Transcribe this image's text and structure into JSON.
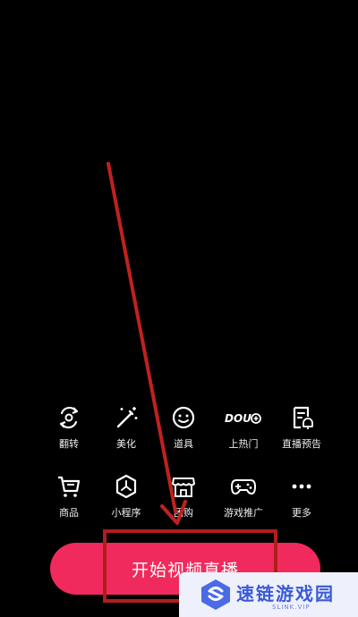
{
  "toolbar_row1": [
    {
      "label": "翻转",
      "icon": "flip-camera-icon"
    },
    {
      "label": "美化",
      "icon": "magic-wand-icon"
    },
    {
      "label": "道具",
      "icon": "smiley-face-icon"
    },
    {
      "label": "上热门",
      "icon": "dou-plus-icon",
      "icon_text": "DOU"
    },
    {
      "label": "直播预告",
      "icon": "schedule-bell-icon"
    }
  ],
  "toolbar_row2": [
    {
      "label": "商品",
      "icon": "shopping-cart-icon"
    },
    {
      "label": "小程序",
      "icon": "mini-program-icon"
    },
    {
      "label": "团购",
      "icon": "group-buy-store-icon"
    },
    {
      "label": "游戏推广",
      "icon": "gamepad-icon"
    },
    {
      "label": "更多",
      "icon": "more-dots-icon"
    }
  ],
  "start_button": {
    "label": "开始视频直播"
  },
  "watermark": {
    "title": "速链游戏园",
    "subtitle": "SLINK.VIP"
  },
  "colors": {
    "background": "#000000",
    "accent": "#f02a5c",
    "annotation": "#c0211f",
    "watermark": "#3a5ad8"
  }
}
